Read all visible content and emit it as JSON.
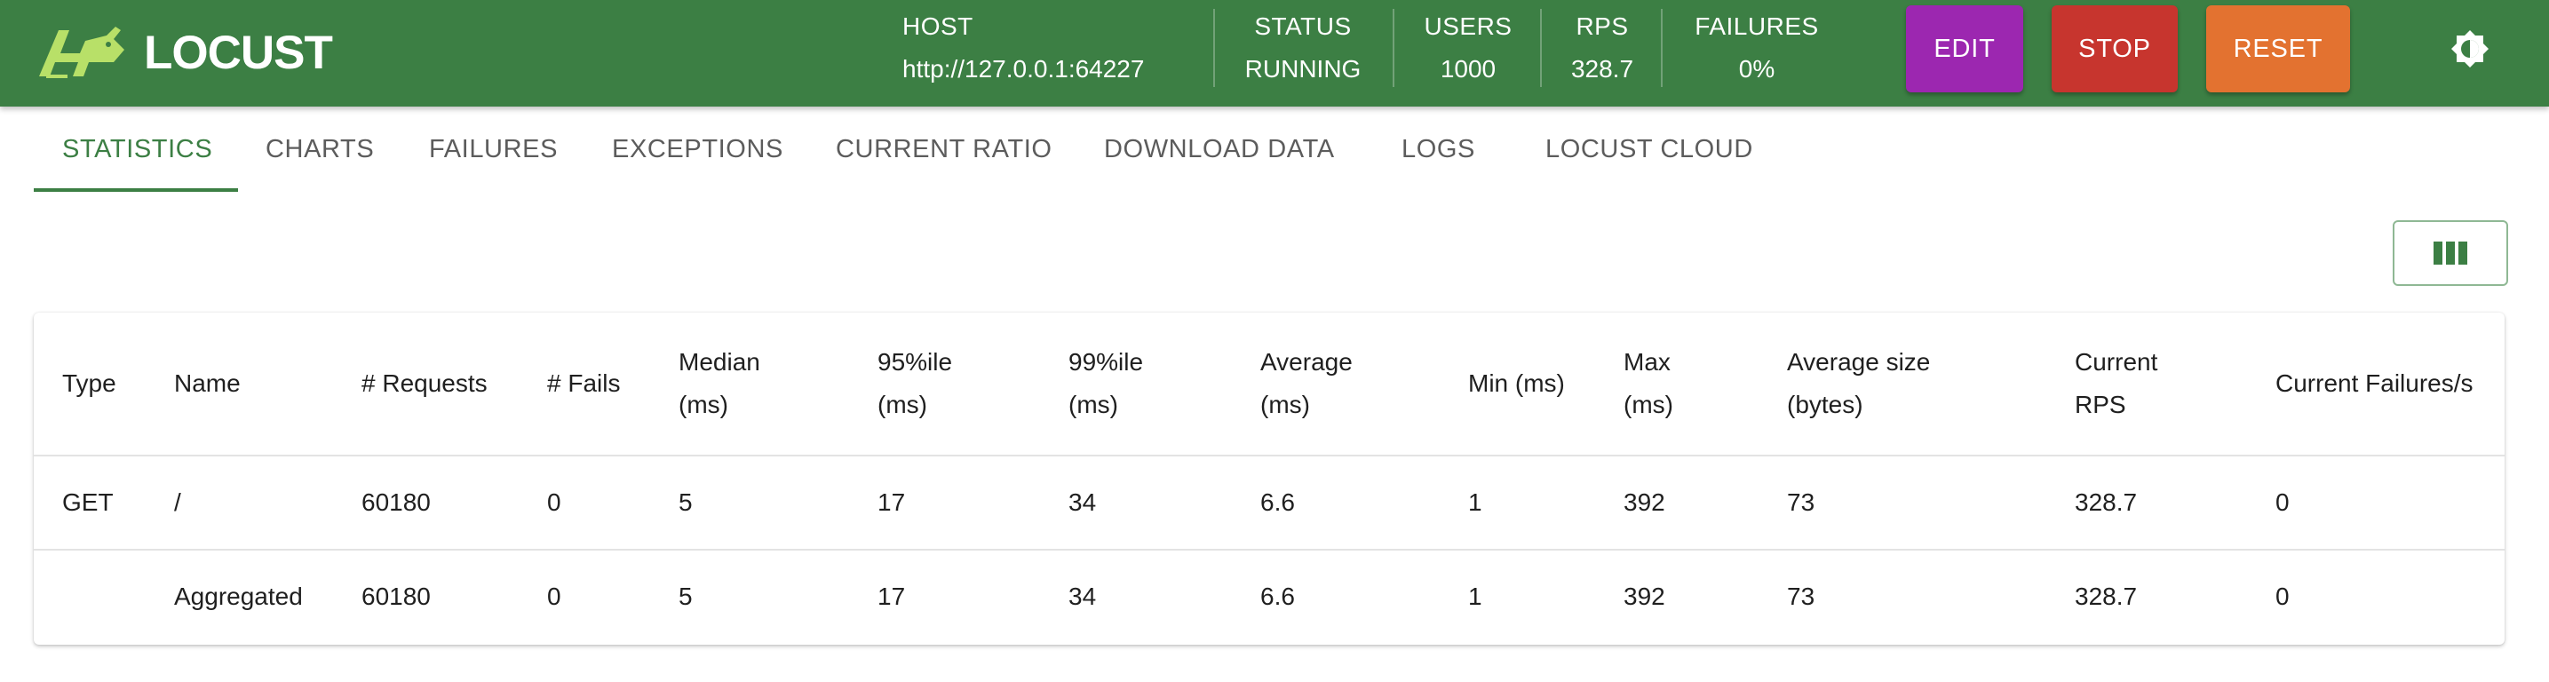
{
  "header": {
    "logo_text": "LOCUST",
    "stats": {
      "host_label": "HOST",
      "host_value": "http://127.0.0.1:64227",
      "status_label": "STATUS",
      "status_value": "RUNNING",
      "users_label": "USERS",
      "users_value": "1000",
      "rps_label": "RPS",
      "rps_value": "328.7",
      "failures_label": "FAILURES",
      "failures_value": "0%"
    },
    "buttons": {
      "edit": "EDIT",
      "stop": "STOP",
      "reset": "RESET"
    },
    "colors": {
      "bar": "#3c7f44",
      "edit": "#9c27b0",
      "stop": "#c7352e",
      "reset": "#e37230"
    }
  },
  "tabs": [
    {
      "label": "STATISTICS",
      "active": true
    },
    {
      "label": "CHARTS"
    },
    {
      "label": "FAILURES"
    },
    {
      "label": "EXCEPTIONS"
    },
    {
      "label": "CURRENT RATIO"
    },
    {
      "label": "DOWNLOAD DATA"
    },
    {
      "label": "LOGS"
    },
    {
      "label": "LOCUST CLOUD"
    }
  ],
  "table": {
    "columns": [
      {
        "line1": "Type",
        "line2": ""
      },
      {
        "line1": "Name",
        "line2": ""
      },
      {
        "line1": "# Requests",
        "line2": ""
      },
      {
        "line1": "# Fails",
        "line2": ""
      },
      {
        "line1": "Median",
        "line2": "(ms)"
      },
      {
        "line1": "95%ile",
        "line2": "(ms)"
      },
      {
        "line1": "99%ile",
        "line2": "(ms)"
      },
      {
        "line1": "Average",
        "line2": "(ms)"
      },
      {
        "line1": "Min (ms)",
        "line2": ""
      },
      {
        "line1": "Max",
        "line2": "(ms)"
      },
      {
        "line1": "Average size",
        "line2": "(bytes)"
      },
      {
        "line1": "Current",
        "line2": "RPS"
      },
      {
        "line1": "Current Failures/s",
        "line2": ""
      }
    ],
    "rows": [
      [
        "GET",
        "/",
        "60180",
        "0",
        "5",
        "17",
        "34",
        "6.6",
        "1",
        "392",
        "73",
        "328.7",
        "0"
      ],
      [
        "",
        "Aggregated",
        "60180",
        "0",
        "5",
        "17",
        "34",
        "6.6",
        "1",
        "392",
        "73",
        "328.7",
        "0"
      ]
    ]
  }
}
